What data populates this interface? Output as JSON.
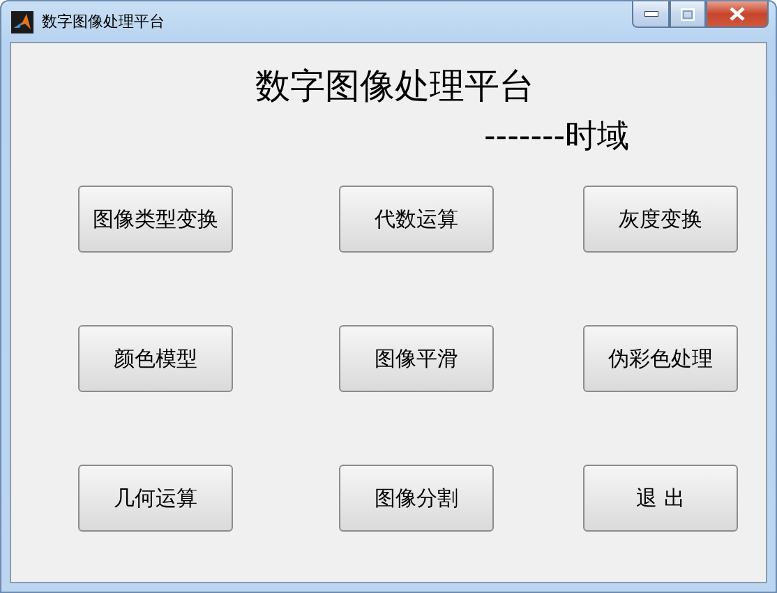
{
  "window": {
    "title": "数字图像处理平台"
  },
  "heading": {
    "title": "数字图像处理平台",
    "subtitle": "-------时域"
  },
  "buttons": [
    {
      "label": "图像类型变换"
    },
    {
      "label": "代数运算"
    },
    {
      "label": "灰度变换"
    },
    {
      "label": "颜色模型"
    },
    {
      "label": "图像平滑"
    },
    {
      "label": "伪彩色处理"
    },
    {
      "label": "几何运算"
    },
    {
      "label": "图像分割"
    },
    {
      "label": "退 出"
    }
  ]
}
